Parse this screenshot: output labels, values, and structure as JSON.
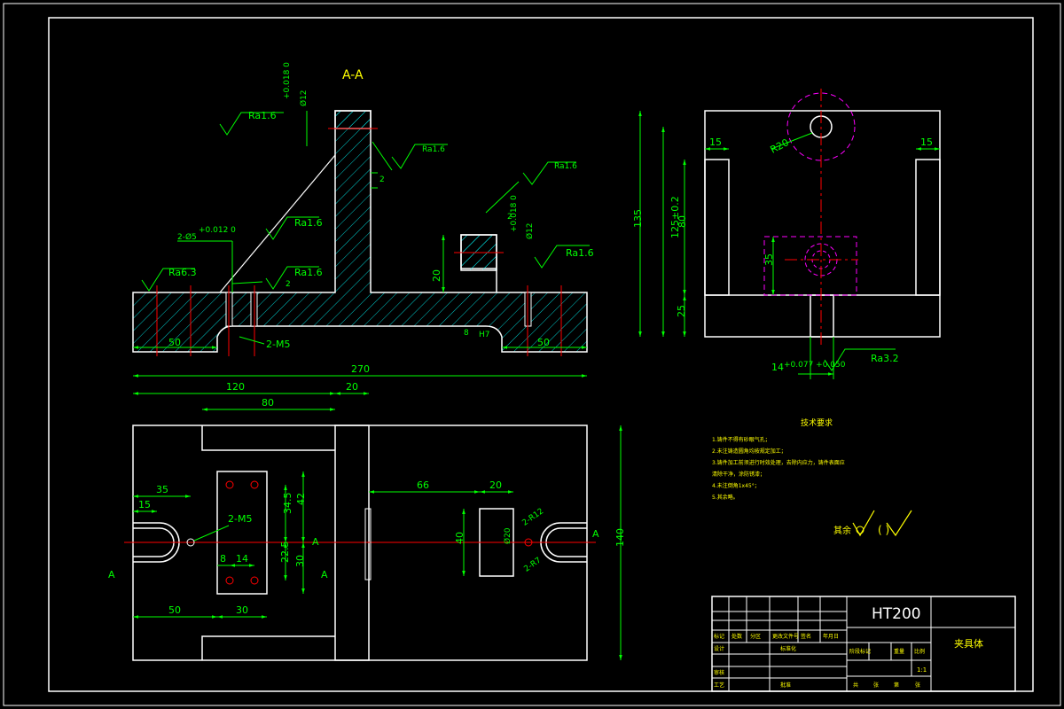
{
  "section_label": "A-A",
  "material": "HT200",
  "part_name": "夹具体",
  "scale": "1:1",
  "tech_requirements": {
    "title": "技术要求",
    "items": [
      "1.铸件不得有砂眼气孔；",
      "2.未注铸造圆角均按规定加工；",
      "3.铸件加工前须进行时效处理，去除内应力，铸件表面应",
      "清除干净，涂防锈漆；",
      "4.未注倒角1x45°；",
      "5.其余略。"
    ],
    "other_label": "其余",
    "other_paren": "(  )"
  },
  "roughness": {
    "r1": "Ra1.6",
    "r2": "Ra1.6",
    "r3": "Ra1.6",
    "r4": "Ra1.6",
    "r5": "Ra1.6",
    "r6": "Ra1.6",
    "r7": "Ra6.3",
    "r8": "Ra3.2"
  },
  "dims": {
    "d_50_left": "50",
    "d_50_right": "50",
    "d_20_v": "20",
    "d_2_a": "2",
    "d_2_b": "2",
    "d_2_c": "2",
    "d_8": "8",
    "d_m5_sec": "2-M5",
    "d_phi12_top": "Ø12",
    "d_phi12_top_tol": "+0.018 0",
    "d_phi12_mid": "Ø12",
    "d_phi12_mid_tol": "+0.018 0",
    "d_phi5": "2-Ø5",
    "d_phi5_tol": "+0.012 0",
    "d_h7": "H7",
    "d_270": "270",
    "d_120": "120",
    "d_20_top": "20",
    "d_80": "80",
    "d_66": "66",
    "d_20_right": "20",
    "d_35": "35",
    "d_15": "15",
    "d_m5_plan": "2-M5",
    "d_34_5": "34.5",
    "d_42": "42",
    "d_22_5": "22.5",
    "d_30_v": "30",
    "d_8_plan": "8",
    "d_14": "14",
    "d_50_plan": "50",
    "d_30_plan": "30",
    "d_140": "140",
    "d_40": "40",
    "d_phi20": "Ø20",
    "d_r12": "2-R12",
    "d_r7": "2-R7",
    "label_A1": "A",
    "label_A2": "A",
    "label_A3": "A",
    "label_A4": "A",
    "d_135": "135",
    "d_125": "125±0.2",
    "d_80_side": "80",
    "d_25": "25",
    "d_35_side": "35",
    "d_15_l": "15",
    "d_15_r": "15",
    "d_r20": "R20",
    "d_14_side": "14",
    "d_14_tol": "+0.077 +0.050"
  },
  "title_block": {
    "c1": "标记",
    "c2": "处数",
    "c3": "分区",
    "c4": "更改文件号",
    "c5": "签名",
    "c6": "年月日",
    "designer": "设计",
    "standard": "标准化",
    "audit": "审核",
    "craft": "工艺",
    "approve": "批准",
    "stage": "阶段标记",
    "weight": "重量",
    "ratio": "比例",
    "sheets_total": "共",
    "sheet": "张",
    "sheet_num": "第",
    "sheet_of": "张"
  },
  "colors": {
    "outline": "#ffffff",
    "dimension": "#00ff00",
    "centerline": "#ff0000",
    "hatch": "#00ffff",
    "hidden": "#ff00ff",
    "text": "#ffff00"
  }
}
